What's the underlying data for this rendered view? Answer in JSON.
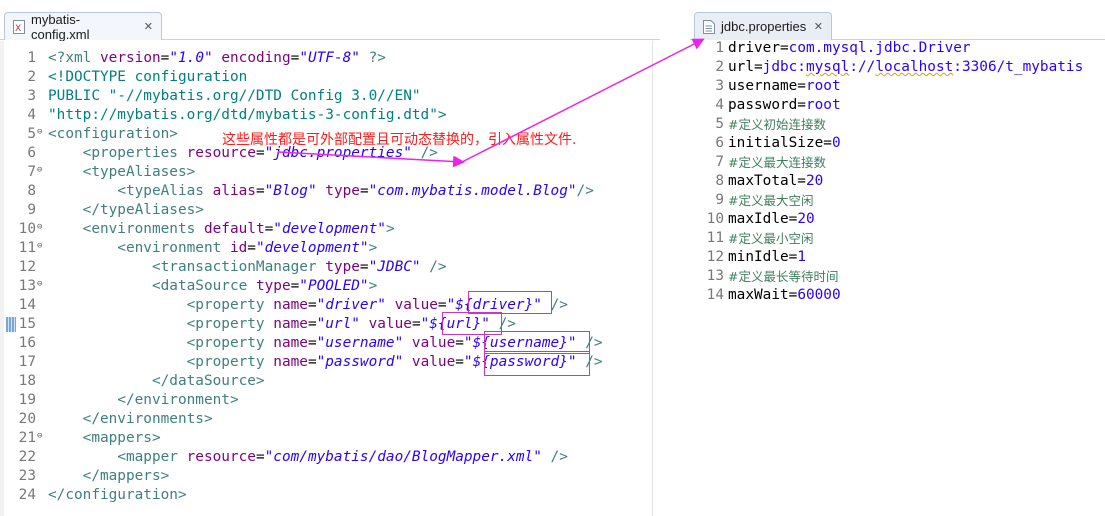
{
  "left_editor": {
    "tab": {
      "label": "mybatis-config.xml",
      "icon": "xml-file-icon",
      "close": "✕"
    },
    "lines": [
      {
        "n": "1",
        "html": "<span class=\"t-pi\">&lt;?xml</span> <span class=\"t-attr\">version</span>=<span class=\"t-val\">\"1.0\"</span> <span class=\"t-attr\">encoding</span>=<span class=\"t-val\">\"UTF-8\"</span> <span class=\"t-pi\">?&gt;</span>"
      },
      {
        "n": "2",
        "html": "<span class=\"t-doctype\">&lt;!DOCTYPE configuration</span>"
      },
      {
        "n": "3",
        "html": "<span class=\"t-doctype\">PUBLIC \"-//mybatis.org//DTD Config 3.0//EN\"</span>"
      },
      {
        "n": "4",
        "html": "<span class=\"t-doctype\">\"http://mybatis.org/dtd/mybatis-3-config.dtd\"&gt;</span>"
      },
      {
        "n": "5",
        "fold": true,
        "html": "<span class=\"t-tag\">&lt;configuration&gt;</span>"
      },
      {
        "n": "6",
        "html": "    <span class=\"t-tag\">&lt;properties</span> <span class=\"t-attr\">resource</span>=<span class=\"t-val\">\"jdbc.properties\"</span> <span class=\"t-tag\">/&gt;</span>"
      },
      {
        "n": "7",
        "fold": true,
        "html": "    <span class=\"t-tag\">&lt;typeAliases&gt;</span>"
      },
      {
        "n": "8",
        "html": "        <span class=\"t-tag\">&lt;typeAlias</span> <span class=\"t-attr\">alias</span>=<span class=\"t-val\">\"Blog\"</span> <span class=\"t-attr\">type</span>=<span class=\"t-val\">\"com.mybatis.model.Blog\"</span><span class=\"t-tag\">/&gt;</span>"
      },
      {
        "n": "9",
        "html": "    <span class=\"t-tag\">&lt;/typeAliases&gt;</span>"
      },
      {
        "n": "10",
        "fold": true,
        "html": "    <span class=\"t-tag\">&lt;environments</span> <span class=\"t-attr\">default</span>=<span class=\"t-val\">\"development\"</span><span class=\"t-tag\">&gt;</span>"
      },
      {
        "n": "11",
        "fold": true,
        "html": "        <span class=\"t-tag\">&lt;environment</span> <span class=\"t-attr\">id</span>=<span class=\"t-val\">\"development\"</span><span class=\"t-tag\">&gt;</span>"
      },
      {
        "n": "12",
        "html": "            <span class=\"t-tag\">&lt;transactionManager</span> <span class=\"t-attr\">type</span>=<span class=\"t-val\">\"JDBC\"</span> <span class=\"t-tag\">/&gt;</span>"
      },
      {
        "n": "13",
        "fold": true,
        "html": "            <span class=\"t-tag\">&lt;dataSource</span> <span class=\"t-attr\">type</span>=<span class=\"t-val\">\"POOLED\"</span><span class=\"t-tag\">&gt;</span>"
      },
      {
        "n": "14",
        "html": "                <span class=\"t-tag\">&lt;property</span> <span class=\"t-attr\">name</span>=<span class=\"t-val\">\"driver\"</span> <span class=\"t-attr\">value</span>=<span class=\"t-val\">\"${driver}\"</span> <span class=\"t-tag\">/&gt;</span>"
      },
      {
        "n": "15",
        "current": true,
        "html": "                <span class=\"t-tag\">&lt;property</span> <span class=\"t-attr\">name</span>=<span class=\"t-val\">\"url\"</span> <span class=\"t-attr\">value</span>=<span class=\"t-val\">\"${url}\"</span> <span class=\"t-tag\">/&gt;</span>"
      },
      {
        "n": "16",
        "html": "                <span class=\"t-tag\">&lt;property</span> <span class=\"t-attr\">name</span>=<span class=\"t-val\">\"username\"</span> <span class=\"t-attr\">value</span>=<span class=\"t-val\">\"${username}\"</span> <span class=\"t-tag\">/&gt;</span>"
      },
      {
        "n": "17",
        "html": "                <span class=\"t-tag\">&lt;property</span> <span class=\"t-attr\">name</span>=<span class=\"t-val\">\"password\"</span> <span class=\"t-attr\">value</span>=<span class=\"t-val\">\"${password}\"</span> <span class=\"t-tag\">/&gt;</span>"
      },
      {
        "n": "18",
        "html": "            <span class=\"t-tag\">&lt;/dataSource&gt;</span>"
      },
      {
        "n": "19",
        "html": "        <span class=\"t-tag\">&lt;/environment&gt;</span>"
      },
      {
        "n": "20",
        "html": "    <span class=\"t-tag\">&lt;/environments&gt;</span>"
      },
      {
        "n": "21",
        "fold": true,
        "html": "    <span class=\"t-tag\">&lt;mappers&gt;</span>"
      },
      {
        "n": "22",
        "html": "        <span class=\"t-tag\">&lt;mapper</span> <span class=\"t-attr\">resource</span>=<span class=\"t-val\">\"com/mybatis/dao/BlogMapper.xml\"</span> <span class=\"t-tag\">/&gt;</span>"
      },
      {
        "n": "23",
        "html": "    <span class=\"t-tag\">&lt;/mappers&gt;</span>"
      },
      {
        "n": "24",
        "html": "<span class=\"t-tag\">&lt;/configuration&gt;</span>"
      }
    ],
    "annotation": "这些属性都是可外部配置且可动态替换的，引入属性文件."
  },
  "right_editor": {
    "tab": {
      "label": "jdbc.properties",
      "icon": "text-file-icon",
      "close": "✕"
    },
    "lines": [
      {
        "n": "1",
        "html": "<span class=\"p-key\">driver=</span><span class=\"p-val\">com.mysql.jdbc.Driver</span>"
      },
      {
        "n": "2",
        "html": "<span class=\"p-key\">url=</span><span class=\"p-val\">jdbc:<span class=\"squiggle\">mysql</span>://<span class=\"squiggle\">localhost</span>:3306/t_mybatis</span>"
      },
      {
        "n": "3",
        "html": "<span class=\"p-key\">username=</span><span class=\"p-val\">root</span>"
      },
      {
        "n": "4",
        "html": "<span class=\"p-key\">password=</span><span class=\"p-val\">root</span>"
      },
      {
        "n": "5",
        "html": "<span class=\"p-comment\">#定义初始连接数</span>"
      },
      {
        "n": "6",
        "html": "<span class=\"p-key\">initialSize=</span><span class=\"p-val\">0</span>"
      },
      {
        "n": "7",
        "html": "<span class=\"p-comment\">#定义最大连接数</span>"
      },
      {
        "n": "8",
        "current": true,
        "html": "<span class=\"p-key\">maxTotal=</span><span class=\"p-val\">20</span>"
      },
      {
        "n": "9",
        "html": "<span class=\"p-comment\">#定义最大空闲</span>"
      },
      {
        "n": "10",
        "html": "<span class=\"p-key\">maxIdle=</span><span class=\"p-val\">20</span>"
      },
      {
        "n": "11",
        "html": "<span class=\"p-comment\">#定义最小空闲</span>"
      },
      {
        "n": "12",
        "html": "<span class=\"p-key\">minIdle=</span><span class=\"p-val\">1</span>"
      },
      {
        "n": "13",
        "html": "<span class=\"p-comment\">#定义最长等待时间</span>"
      },
      {
        "n": "14",
        "html": "<span class=\"p-key\">maxWait=</span><span class=\"p-val\">60000</span>"
      }
    ]
  },
  "colors": {
    "annotation": "#ff1a1a",
    "arrow": "#ee22ee",
    "box": "#cc33cc",
    "current_line": "#e8f2fe"
  }
}
